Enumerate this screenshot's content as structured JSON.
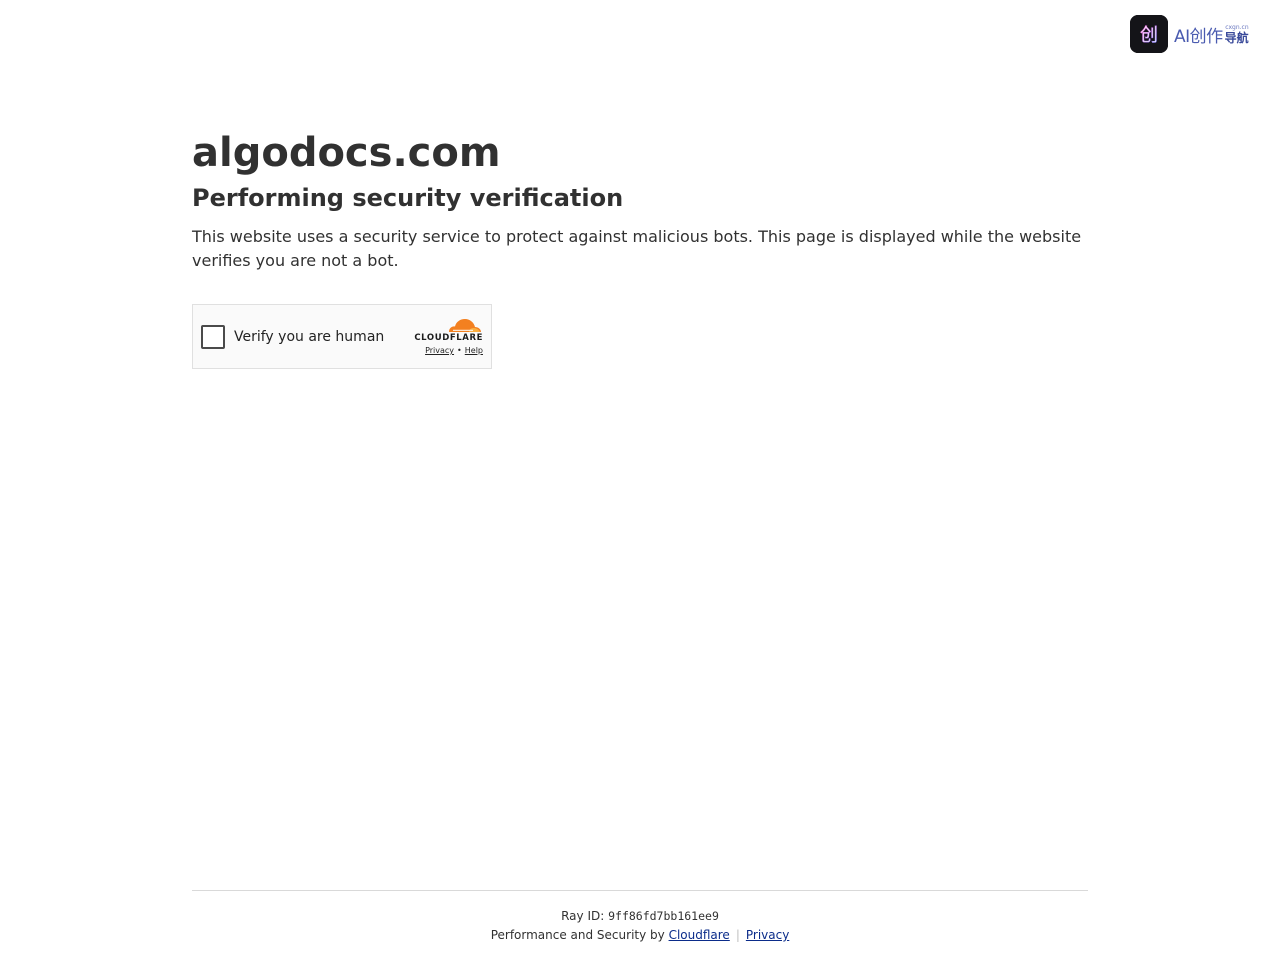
{
  "brand_logo": {
    "mark_glyph": "创",
    "main": "AI创作",
    "sub": "cxgn.cn",
    "nav": "导航"
  },
  "main": {
    "site_name": "algodocs.com",
    "headline": "Performing security verification",
    "description": "This website uses a security service to protect against malicious bots. This page is displayed while the website verifies you are not a bot."
  },
  "widget": {
    "checkbox_checked": false,
    "label": "Verify you are human",
    "brand_wordmark": "CLOUDFLARE",
    "privacy_link": "Privacy",
    "separator": "•",
    "help_link": "Help",
    "cloud_colors": [
      "#f38020",
      "#faae40"
    ]
  },
  "footer": {
    "ray_label": "Ray ID: ",
    "ray_value": "9ff86fd7bb161ee9",
    "perf_text": "Performance and Security by ",
    "cloudflare_link": "Cloudflare",
    "separator": "|",
    "privacy_link": "Privacy"
  },
  "colors": {
    "text": "#313131",
    "link": "#0b2c8a",
    "brand_accent": "#4a5bb0"
  }
}
